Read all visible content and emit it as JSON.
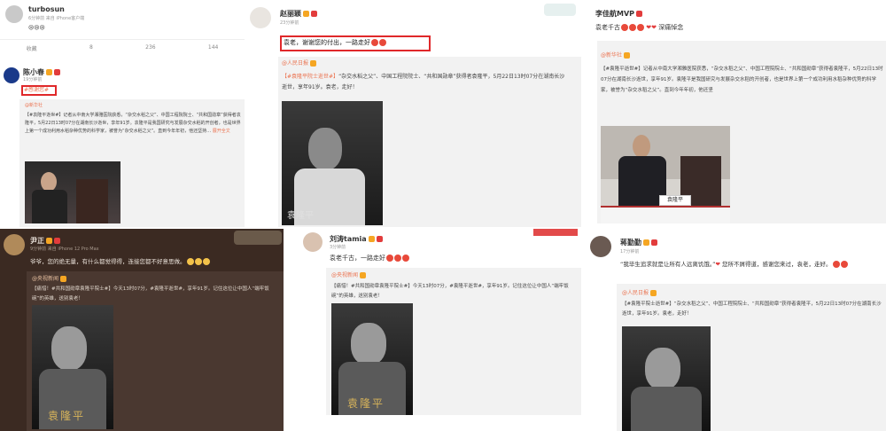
{
  "p1": {
    "name": "turbosun",
    "meta": "6分钟前 来自 iPhone客户端",
    "text": "😢😢😢",
    "actions": [
      "收藏",
      "8",
      "236",
      "144"
    ]
  },
  "p2": {
    "name": "陈小春",
    "meta": "19分钟前",
    "text": "#感谢您#",
    "repost_author": "@新华社",
    "repost_text": "【#袁隆平逝世#】记者从中南大学湘雅医院获悉，“杂交水稻之父”、中国工程院院士、“共和国勋章”获得者袁隆平，5月22日13时07分在湖南长沙逝世，享年91岁。袁隆平是我国研究与发展杂交水稻的开创者，也是世界上第一个成功利用水稻杂种优势的科学家，被誉为“杂交水稻之父”。直到今年年初，他还坚持…",
    "repost_more": "展开全文"
  },
  "p3": {
    "name": "赵丽颖",
    "meta": "23分钟前",
    "text": "袁老，谢谢您的付出，一路走好",
    "repost_author": "@人民日报",
    "repost_text_tag": "【#袁隆平院士逝世#】",
    "repost_text": "“杂交水稻之父”、中国工程院院士、“共和国勋章”获得者袁隆平，5月22日13时07分在湖南长沙逝世，享年91岁。袁老，走好！",
    "photo_caption": "袁隆平"
  },
  "p4": {
    "name": "李佳航MVP",
    "text": "袁老千古",
    "text_tail": "深痛悼念",
    "repost_author": "@新华社",
    "repost_text": "【#袁隆平逝世#】记者从中南大学湘雅医院获悉，“杂交水稻之父”、中国工程院院士、“共和国勋章”获得者袁隆平，5月22日13时07分在湖南长沙逝世，享年91岁。袁隆平是我国研究与发展杂交水稻的开创者，也是世界上第一个成功利用水稻杂种优势的科学家，被誉为“杂交水稻之父”。直到今年年初，他还坚",
    "nameplate": "袁隆平"
  },
  "p5": {
    "name": "尹正",
    "meta": "9分钟前 来自 iPhone 12 Pro Max",
    "text": "爷爷，您的绝无量，有什么都觉得得，连接您都不好意思做。",
    "repost_author": "@央视新闻",
    "repost_text": "【痛惜！#共和国勋章袁隆平院士#】今天13时07分，#袁隆平逝世#，享年91岁。记住这位让中国人“端牢饭碗”的英雄，送别袁老！",
    "photo_caption": "袁隆平"
  },
  "p6": {
    "name": "刘涛tamia",
    "meta": "3分钟前",
    "text": "袁老千古，一路走好",
    "repost_author": "@央视新闻",
    "repost_text": "【痛惜！#共和国勋章袁隆平院士#】今天13时07分，#袁隆平逝世#，享年91岁。记住这位让中国人“端牢饭碗”的英雄，送别袁老！",
    "photo_caption": "袁隆平"
  },
  "p7": {
    "name": "蒋勤勤",
    "meta": "17分钟前",
    "text": "“我毕生追求就是让所有人远离饥饿。”",
    "text_tail": "您所不屑得道，感谢您来过，袁老，走好。",
    "repost_author": "@人民日报",
    "repost_text": "【#袁隆平院士逝世#】“杂交水稻之父”、中国工程院院士、“共和国勋章”获得者袁隆平，5月22日13时07分在湖南长沙逝世，享年91岁。袁老，走好！"
  },
  "colors": {
    "highlight": "#e0282a",
    "link": "#eb7350",
    "dark_panel": "#3b2a22"
  }
}
